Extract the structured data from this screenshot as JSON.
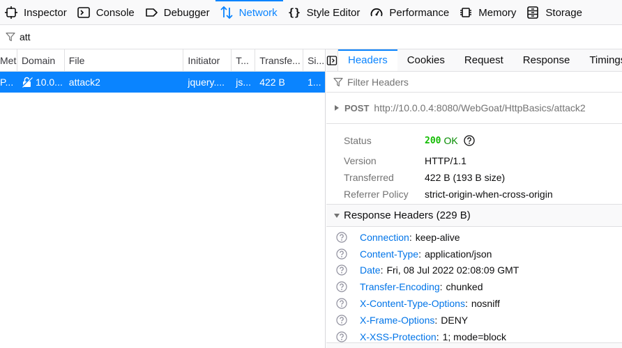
{
  "toolbar": {
    "tabs": [
      {
        "label": "Inspector",
        "icon": "inspector-icon"
      },
      {
        "label": "Console",
        "icon": "console-icon"
      },
      {
        "label": "Debugger",
        "icon": "debugger-icon"
      },
      {
        "label": "Network",
        "icon": "network-icon",
        "active": true
      },
      {
        "label": "Style Editor",
        "icon": "style-editor-icon"
      },
      {
        "label": "Performance",
        "icon": "performance-icon"
      },
      {
        "label": "Memory",
        "icon": "memory-icon"
      },
      {
        "label": "Storage",
        "icon": "storage-icon"
      }
    ]
  },
  "filter": {
    "value": "att"
  },
  "request_list": {
    "columns": [
      "Met",
      "Domain",
      "File",
      "Initiator",
      "T...",
      "Transfe...",
      "Si..."
    ],
    "rows": [
      {
        "method": "P...",
        "domain": "10.0...",
        "file": "attack2",
        "initiator": "jquery....",
        "type": "js...",
        "transferred": "422 B",
        "size": "1..."
      }
    ]
  },
  "details": {
    "tabs": [
      "Headers",
      "Cookies",
      "Request",
      "Response",
      "Timings"
    ],
    "active_tab": "Headers",
    "filter_placeholder": "Filter Headers",
    "summary": {
      "method": "POST",
      "url": "http://10.0.0.4:8080/WebGoat/HttpBasics/attack2"
    },
    "status": {
      "label": "Status",
      "code": "200",
      "text": "OK",
      "rows": [
        {
          "key": "Version",
          "value": "HTTP/1.1"
        },
        {
          "key": "Transferred",
          "value": "422 B (193 B size)"
        },
        {
          "key": "Referrer Policy",
          "value": "strict-origin-when-cross-origin"
        }
      ]
    },
    "response_headers": {
      "title": "Response Headers (229 B)",
      "items": [
        {
          "name": "Connection",
          "value": "keep-alive"
        },
        {
          "name": "Content-Type",
          "value": "application/json"
        },
        {
          "name": "Date",
          "value": "Fri, 08 Jul 2022 02:08:09 GMT"
        },
        {
          "name": "Transfer-Encoding",
          "value": "chunked"
        },
        {
          "name": "X-Content-Type-Options",
          "value": "nosniff"
        },
        {
          "name": "X-Frame-Options",
          "value": "DENY"
        },
        {
          "name": "X-XSS-Protection",
          "value": "1; mode=block"
        }
      ]
    }
  },
  "colors": {
    "accent": "#0a84ff",
    "status_ok": "#12bc00",
    "header_name": "#0074e8"
  }
}
